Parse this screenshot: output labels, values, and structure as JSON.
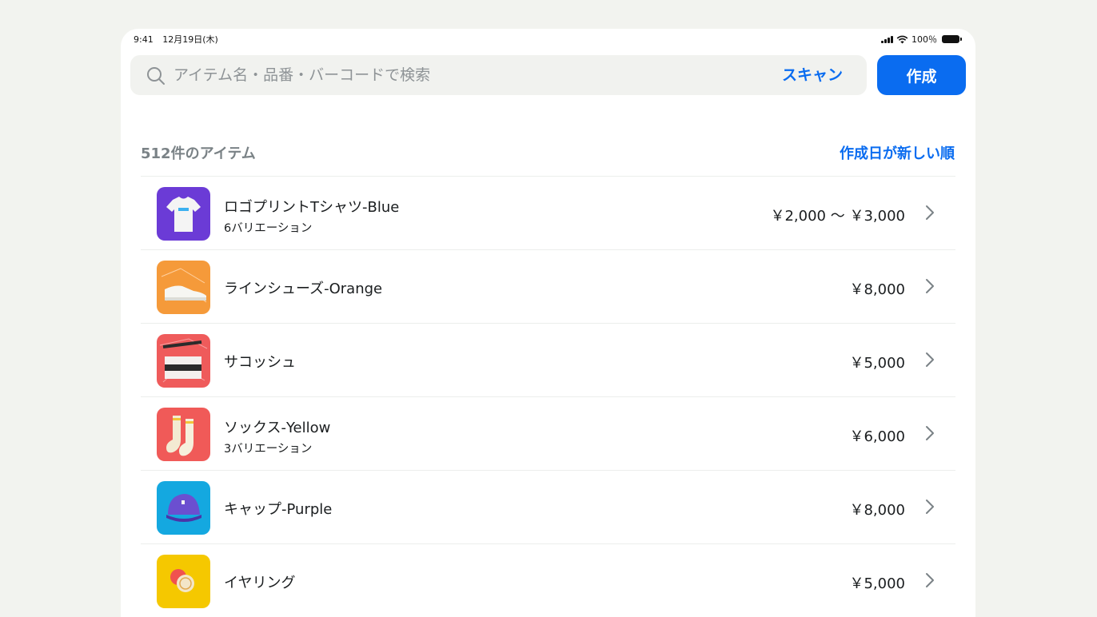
{
  "status_bar": {
    "time": "9:41",
    "date": "12月19日(木)",
    "battery": "100％"
  },
  "search": {
    "placeholder": "アイテム名・品番・バーコードで検索",
    "value": "",
    "scan_label": "スキャン"
  },
  "create_label": "作成",
  "list": {
    "count_label": "512件のアイテム",
    "sort_label": "作成日が新しい順",
    "items": [
      {
        "name": "ロゴプリントTシャツ-Blue",
        "variations": "6バリエーション",
        "price": "￥2,000 〜 ￥3,000",
        "thumb_bg": "#6b3bd6",
        "icon": "tshirt-icon"
      },
      {
        "name": "ラインシューズ-Orange",
        "variations": "",
        "price": "￥8,000",
        "thumb_bg": "#f59a3a",
        "icon": "shoe-icon"
      },
      {
        "name": "サコッシュ",
        "variations": "",
        "price": "￥5,000",
        "thumb_bg": "#ef5b5b",
        "icon": "bag-icon"
      },
      {
        "name": "ソックス-Yellow",
        "variations": "3バリエーション",
        "price": "￥6,000",
        "thumb_bg": "#f05a58",
        "icon": "socks-icon"
      },
      {
        "name": "キャップ-Purple",
        "variations": "",
        "price": "￥8,000",
        "thumb_bg": "#14a8e0",
        "icon": "cap-icon"
      },
      {
        "name": "イヤリング",
        "variations": "",
        "price": "￥5,000",
        "thumb_bg": "#f5c800",
        "icon": "earring-icon"
      }
    ]
  },
  "colors": {
    "accent": "#0a6cf0",
    "muted": "#7a8286"
  }
}
